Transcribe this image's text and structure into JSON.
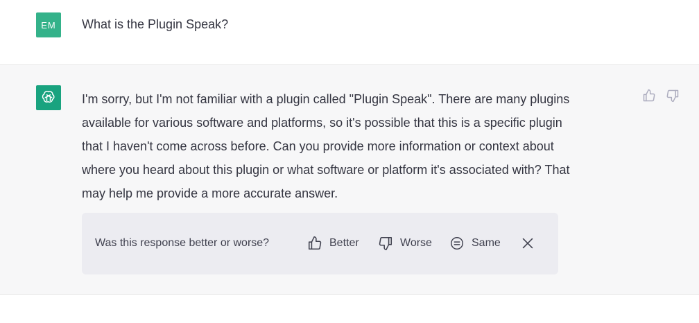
{
  "user_message": {
    "avatar_initials": "EM",
    "avatar_color": "#34b28a",
    "text": "What is the Plugin Speak?"
  },
  "assistant_message": {
    "avatar_icon": "openai-logo-icon",
    "avatar_color": "#19a37f",
    "lines": [
      "I'm sorry, but I'm not familiar with a plugin called \"Plugin Speak\". There are many plugins",
      "available for various software and platforms, so it's possible that this is a specific plugin",
      "that I haven't come across before. Can you provide more information or context about",
      "where you heard about this plugin or what software or platform it's associated with? That",
      "may help me provide a more accurate answer."
    ],
    "rating_icons": [
      "thumbs-up-icon",
      "thumbs-down-icon"
    ]
  },
  "feedback": {
    "question": "Was this response better or worse?",
    "better_label": "Better",
    "worse_label": "Worse",
    "same_label": "Same",
    "close_icon": "close-icon"
  }
}
